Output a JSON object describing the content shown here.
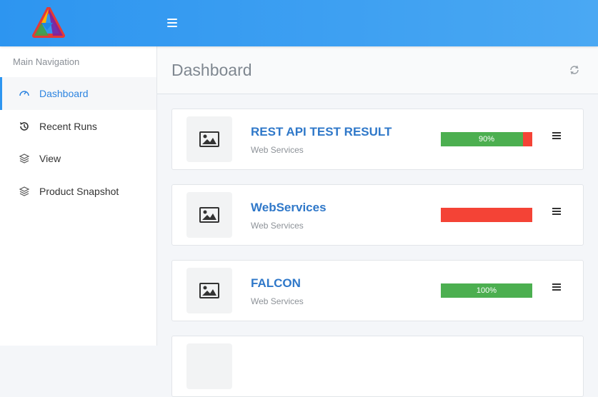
{
  "colors": {
    "topbar_start": "#2d95f0",
    "topbar_end": "#4aa8f3",
    "accent": "#2d84e0",
    "title_link": "#2f78c9",
    "pass": "#4caf50",
    "fail": "#f44336"
  },
  "header": {
    "logo_icon": "triangle-logo-icon",
    "menu_icon": "hamburger-icon"
  },
  "sidebar": {
    "heading": "Main Navigation",
    "items": [
      {
        "label": "Dashboard",
        "icon": "gauge-icon",
        "active": true
      },
      {
        "label": "Recent Runs",
        "icon": "history-icon",
        "active": false
      },
      {
        "label": "View",
        "icon": "layers-icon",
        "active": false
      },
      {
        "label": "Product Snapshot",
        "icon": "layers-icon",
        "active": false
      }
    ]
  },
  "main": {
    "title": "Dashboard",
    "refresh_icon": "refresh-icon",
    "cards": [
      {
        "title": "REST API TEST RESULT",
        "subtitle": "Web Services",
        "pass_percent": 90,
        "progress_label": "90%"
      },
      {
        "title": "WebServices",
        "subtitle": "Web Services",
        "pass_percent": 0,
        "progress_label": ""
      },
      {
        "title": "FALCON",
        "subtitle": "Web Services",
        "pass_percent": 100,
        "progress_label": "100%"
      }
    ]
  }
}
